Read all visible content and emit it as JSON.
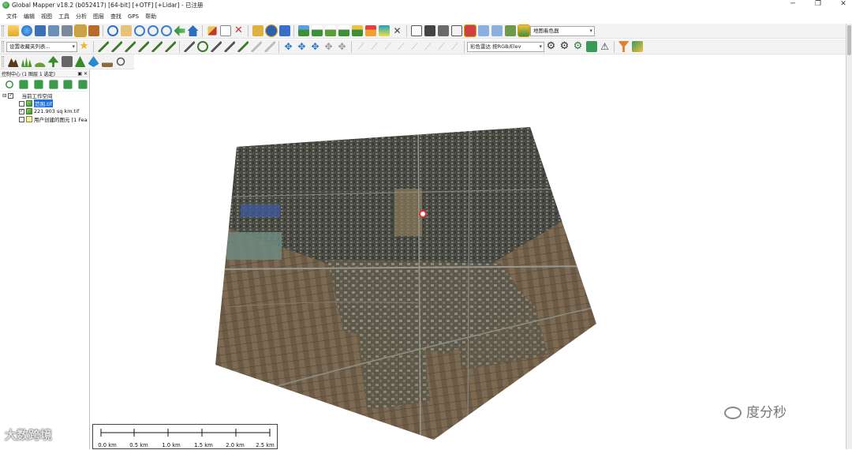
{
  "window": {
    "title": "Global Mapper v18.2 (b052417) [64-bit] [+OTF] [+Lidar] - 已注册",
    "controls": {
      "minimize": "─",
      "maximize": "❐",
      "close": "✕"
    }
  },
  "menu": [
    "文件",
    "编辑",
    "视图",
    "工具",
    "分析",
    "图层",
    "查找",
    "GPS",
    "帮助"
  ],
  "toolbar": {
    "shader_select": "地图着色器",
    "favorites_select": "设置收藏夹列表...",
    "lidar_color_select": "彩色雷达 按RGB/Elev"
  },
  "control_center": {
    "title": "控制中心 (1 图层 1 选定)",
    "pin": "▣",
    "close": "✕",
    "tree": {
      "root_label": "当前工作空间",
      "root_expand": "⊟",
      "layers": [
        {
          "label": "范围.tif",
          "checked": false,
          "selected": true
        },
        {
          "label": "221.903 sq km.tif",
          "checked": true,
          "selected": false
        },
        {
          "label": "用户创建的图元 [1 Fea",
          "checked": false,
          "selected": false
        }
      ]
    }
  },
  "map": {
    "polygon_vertices_note": "",
    "marker_color": "#e03030"
  },
  "scalebar": {
    "labels": [
      "0.0 km",
      "0.5 km",
      "1.0 km",
      "1.5 km",
      "2.0 km",
      "2.5 km"
    ]
  },
  "watermarks": {
    "bottom_left": "大数跨境",
    "bottom_right": "度分秒"
  },
  "colors": {
    "selection": "#1e6fd9",
    "toolbar_bg": "#f3f3f3"
  }
}
